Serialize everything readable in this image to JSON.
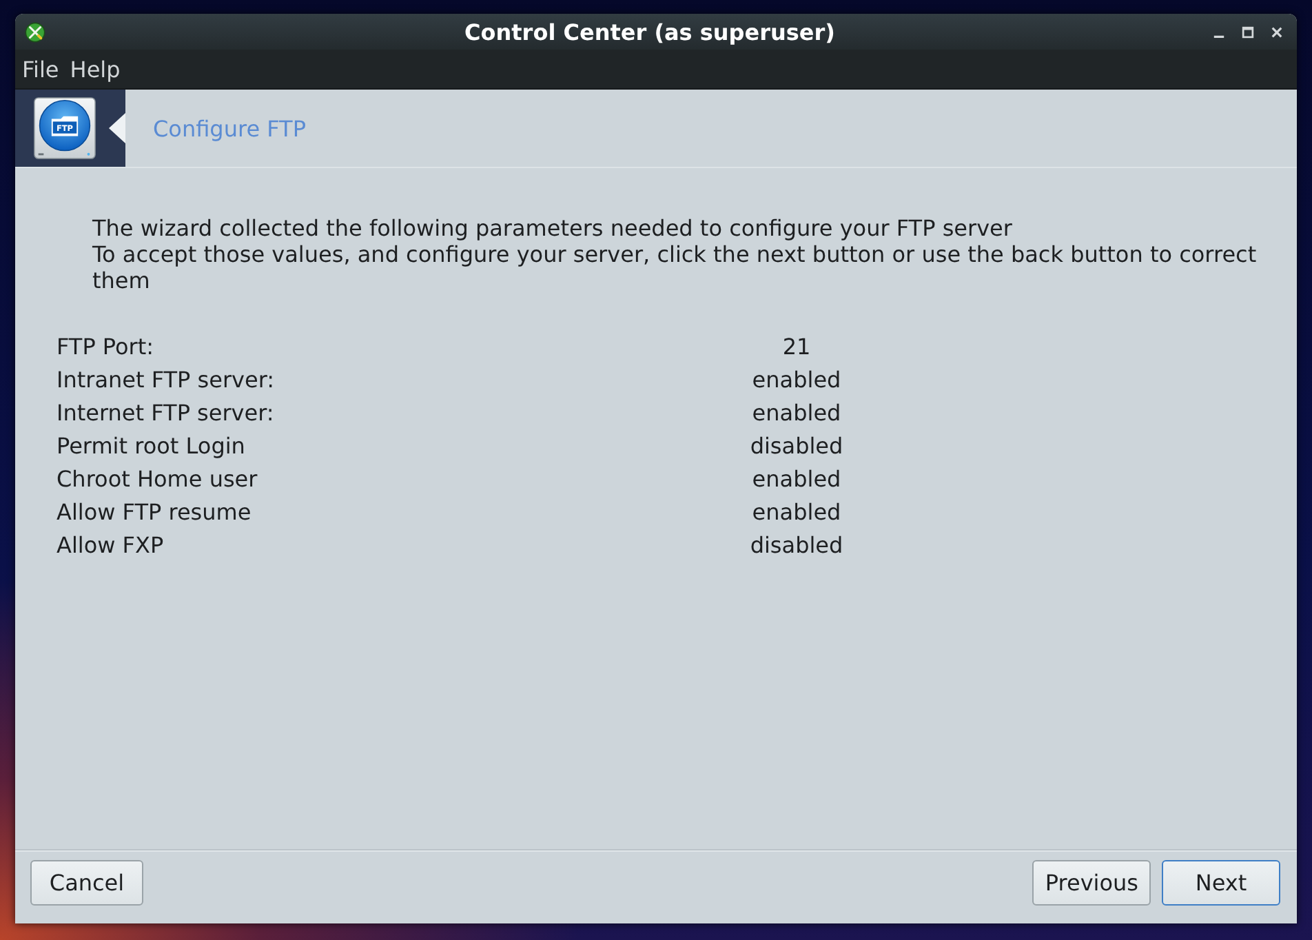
{
  "window": {
    "title": "Control Center (as superuser)"
  },
  "menu": [
    {
      "label": "File"
    },
    {
      "label": "Help"
    }
  ],
  "banner": {
    "icon_label": "FTP",
    "title": "Configure FTP"
  },
  "description": [
    "The wizard collected the following parameters needed to configure your FTP server",
    "To accept those values, and configure your server, click the next button or use the back button to correct them"
  ],
  "parameters": [
    {
      "name": "FTP Port:",
      "value": "21"
    },
    {
      "name": "Intranet FTP server:",
      "value": "enabled"
    },
    {
      "name": "Internet FTP server:",
      "value": "enabled"
    },
    {
      "name": "Permit root Login",
      "value": "disabled"
    },
    {
      "name": "Chroot Home user",
      "value": "enabled"
    },
    {
      "name": "Allow FTP resume",
      "value": "enabled"
    },
    {
      "name": "Allow FXP",
      "value": "disabled"
    }
  ],
  "footer": {
    "start": [
      {
        "label": "Cancel",
        "default": false
      }
    ],
    "end": [
      {
        "label": "Previous",
        "default": false
      },
      {
        "label": "Next",
        "default": true
      }
    ]
  }
}
